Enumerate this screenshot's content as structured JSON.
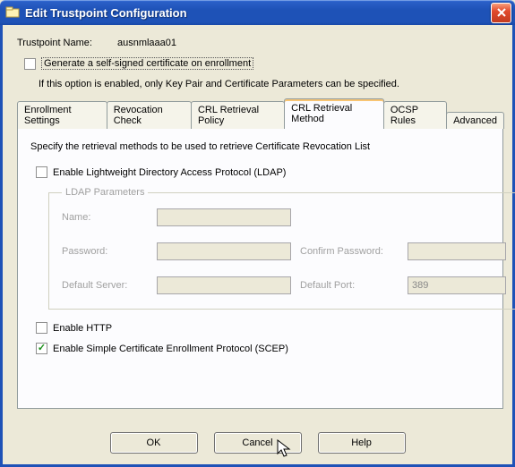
{
  "window": {
    "title": "Edit Trustpoint Configuration"
  },
  "trustpoint": {
    "label": "Trustpoint Name:",
    "value": "ausnmlaaa01"
  },
  "selfsigned": {
    "label": "Generate a self-signed certificate on enrollment",
    "helper": "If this option is enabled, only Key Pair and Certificate Parameters can be specified."
  },
  "tabs": {
    "enrollment": "Enrollment Settings",
    "revocation": "Revocation Check",
    "crl_policy": "CRL Retrieval Policy",
    "crl_method": "CRL Retrieval Method",
    "ocsp": "OCSP Rules",
    "advanced": "Advanced"
  },
  "panel": {
    "desc": "Specify the retrieval methods to be used to retrieve Certificate Revocation List",
    "ldap_check": "Enable Lightweight Directory Access Protocol (LDAP)",
    "ldap_group": "LDAP Parameters",
    "ldap": {
      "name_label": "Name:",
      "password_label": "Password:",
      "confirm_label": "Confirm Password:",
      "server_label": "Default Server:",
      "port_label": "Default Port:",
      "port_value": "389"
    },
    "http_check": "Enable HTTP",
    "scep_check": "Enable Simple Certificate Enrollment Protocol (SCEP)"
  },
  "buttons": {
    "ok": "OK",
    "cancel": "Cancel",
    "help": "Help"
  }
}
